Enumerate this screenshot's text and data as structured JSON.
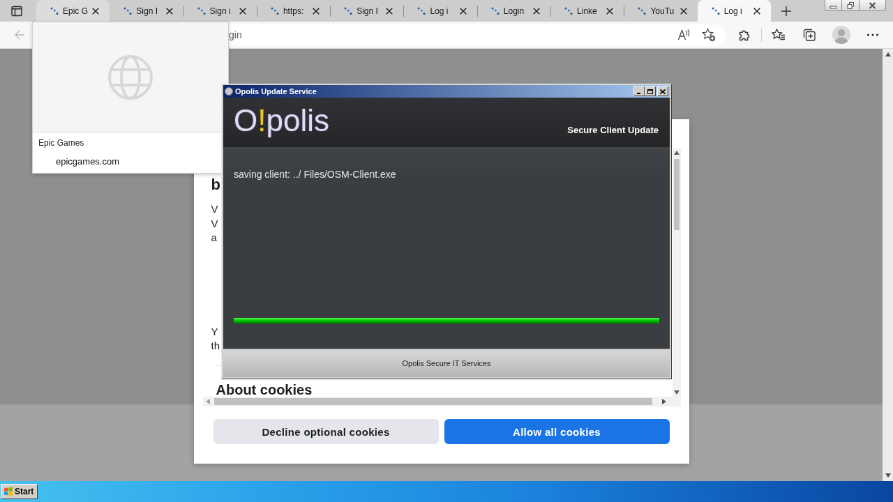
{
  "browser": {
    "tabs": [
      {
        "label": "Epic G",
        "selected": false,
        "hovered": true
      },
      {
        "label": "Sign I",
        "selected": false,
        "hovered": false
      },
      {
        "label": "Sign i",
        "selected": false,
        "hovered": false
      },
      {
        "label": "https:",
        "selected": false,
        "hovered": false
      },
      {
        "label": "Sign I",
        "selected": false,
        "hovered": false
      },
      {
        "label": "Log i",
        "selected": false,
        "hovered": false
      },
      {
        "label": "Login",
        "selected": false,
        "hovered": false
      },
      {
        "label": "Linke",
        "selected": false,
        "hovered": false
      },
      {
        "label": "YouTu",
        "selected": false,
        "hovered": false
      },
      {
        "label": "Log i",
        "selected": true,
        "hovered": false
      }
    ],
    "back_button": {
      "disabled": true
    },
    "address": {
      "value": "gin"
    },
    "hover_card": {
      "title": "Epic Games",
      "domain": "epicgames.com"
    }
  },
  "cookie_dialog": {
    "heading": "b",
    "paragraphs": [
      {
        "lines": [
          "V",
          "V",
          "a"
        ]
      },
      {
        "lines": [
          "Y",
          "th"
        ]
      }
    ],
    "section_heading": "About cookies",
    "buttons": [
      {
        "label": "Decline optional cookies",
        "kind": "secondary"
      },
      {
        "label": "Allow all cookies",
        "kind": "primary"
      }
    ]
  },
  "app_window": {
    "title": "Opolis Update Service",
    "logo": [
      {
        "text": "O",
        "accent": false
      },
      {
        "text": "!",
        "accent": true
      },
      {
        "text": "polis",
        "accent": false
      }
    ],
    "subtitle": "Secure Client Update",
    "status": "saving client: ../ Files/OSM-Client.exe",
    "progress": {
      "level": 1
    },
    "footer": "Opolis Secure IT Services"
  },
  "taskbar": {
    "start_label": "Start"
  }
}
